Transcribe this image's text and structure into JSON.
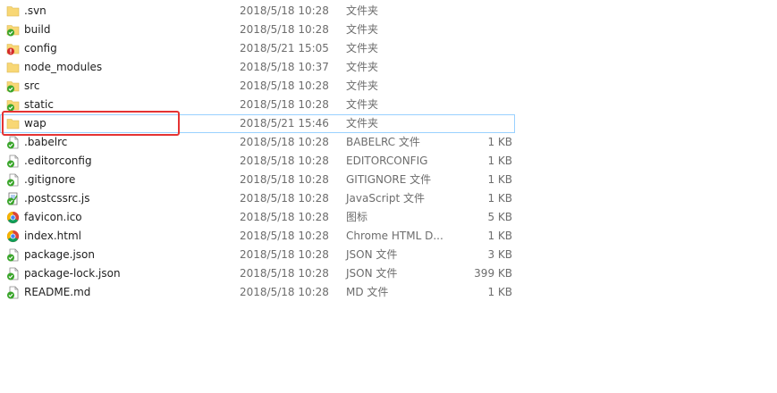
{
  "files": [
    {
      "name": ".svn",
      "date": "2018/5/18 10:28",
      "type": "文件夹",
      "size": "",
      "icon": "folder-icon"
    },
    {
      "name": "build",
      "date": "2018/5/18 10:28",
      "type": "文件夹",
      "size": "",
      "icon": "folder-synced-icon"
    },
    {
      "name": "config",
      "date": "2018/5/21 15:05",
      "type": "文件夹",
      "size": "",
      "icon": "folder-modified-icon"
    },
    {
      "name": "node_modules",
      "date": "2018/5/18 10:37",
      "type": "文件夹",
      "size": "",
      "icon": "folder-icon"
    },
    {
      "name": "src",
      "date": "2018/5/18 10:28",
      "type": "文件夹",
      "size": "",
      "icon": "folder-synced-icon"
    },
    {
      "name": "static",
      "date": "2018/5/18 10:28",
      "type": "文件夹",
      "size": "",
      "icon": "folder-synced-icon"
    },
    {
      "name": "wap",
      "date": "2018/5/21 15:46",
      "type": "文件夹",
      "size": "",
      "icon": "folder-icon"
    },
    {
      "name": ".babelrc",
      "date": "2018/5/18 10:28",
      "type": "BABELRC 文件",
      "size": "1 KB",
      "icon": "file-synced-icon"
    },
    {
      "name": ".editorconfig",
      "date": "2018/5/18 10:28",
      "type": "EDITORCONFIG",
      "size": "1 KB",
      "icon": "file-synced-icon"
    },
    {
      "name": ".gitignore",
      "date": "2018/5/18 10:28",
      "type": "GITIGNORE 文件",
      "size": "1 KB",
      "icon": "file-synced-icon"
    },
    {
      "name": ".postcssrc.js",
      "date": "2018/5/18 10:28",
      "type": "JavaScript 文件",
      "size": "1 KB",
      "icon": "script-file-synced-icon"
    },
    {
      "name": "favicon.ico",
      "date": "2018/5/18 10:28",
      "type": "图标",
      "size": "5 KB",
      "icon": "chrome-icon"
    },
    {
      "name": "index.html",
      "date": "2018/5/18 10:28",
      "type": "Chrome HTML D...",
      "size": "1 KB",
      "icon": "chrome-icon"
    },
    {
      "name": "package.json",
      "date": "2018/5/18 10:28",
      "type": "JSON 文件",
      "size": "3 KB",
      "icon": "file-synced-icon"
    },
    {
      "name": "package-lock.json",
      "date": "2018/5/18 10:28",
      "type": "JSON 文件",
      "size": "399 KB",
      "icon": "file-synced-icon"
    },
    {
      "name": "README.md",
      "date": "2018/5/18 10:28",
      "type": "MD 文件",
      "size": "1 KB",
      "icon": "file-synced-icon"
    }
  ],
  "selected_index": 6,
  "colors": {
    "highlight_box": "#e53333",
    "selection_outline": "#99d1ff",
    "folder": "#f8d775",
    "sync_ok": "#3aa52b",
    "modified": "#d42b2b"
  }
}
